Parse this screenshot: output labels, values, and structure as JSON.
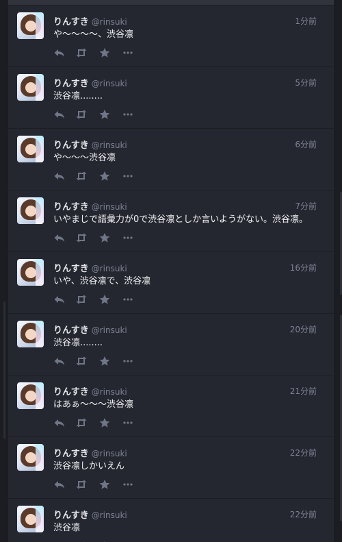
{
  "colors": {
    "background": "#16181d",
    "column": "#252730",
    "text": "#f1f2f4",
    "muted": "#7c8393",
    "icon": "#6f7687"
  },
  "icons": {
    "reply": "reply-icon",
    "retweet": "retweet-icon",
    "favorite": "star-icon",
    "more": "more-icon"
  },
  "tweets": [
    {
      "name": "りんすき",
      "handle": "@rinsuki",
      "time": "1分前",
      "text": "や〜〜〜〜、渋谷凛"
    },
    {
      "name": "りんすき",
      "handle": "@rinsuki",
      "time": "5分前",
      "text": "渋谷凛........"
    },
    {
      "name": "りんすき",
      "handle": "@rinsuki",
      "time": "6分前",
      "text": "や〜〜〜渋谷凛"
    },
    {
      "name": "りんすき",
      "handle": "@rinsuki",
      "time": "7分前",
      "text": "いやまじで語彙力が0で渋谷凛としか言いようがない。渋谷凛。"
    },
    {
      "name": "りんすき",
      "handle": "@rinsuki",
      "time": "16分前",
      "text": "いや、渋谷凛で、渋谷凛"
    },
    {
      "name": "りんすき",
      "handle": "@rinsuki",
      "time": "20分前",
      "text": "渋谷凛........"
    },
    {
      "name": "りんすき",
      "handle": "@rinsuki",
      "time": "21分前",
      "text": "はあぁ〜〜〜渋谷凛"
    },
    {
      "name": "りんすき",
      "handle": "@rinsuki",
      "time": "22分前",
      "text": "渋谷凛しかいえん"
    },
    {
      "name": "りんすき",
      "handle": "@rinsuki",
      "time": "22分前",
      "text": "渋谷凛"
    }
  ]
}
